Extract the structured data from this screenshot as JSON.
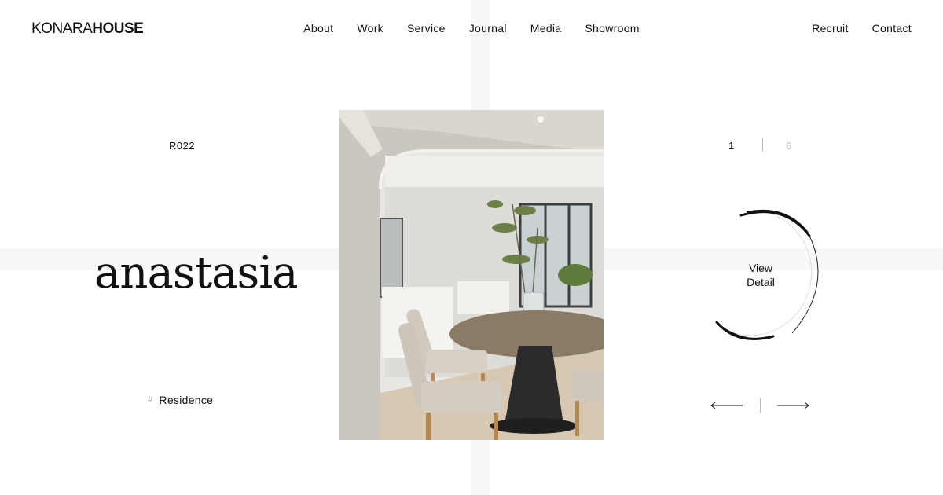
{
  "brand": {
    "logo_light": "KONARA",
    "logo_bold": "HOUSE"
  },
  "nav": {
    "items": [
      "About",
      "Work",
      "Service",
      "Journal",
      "Media",
      "Showroom"
    ],
    "right": [
      "Recruit",
      "Contact"
    ]
  },
  "project": {
    "code": "R022",
    "title": "anastasia",
    "tag_symbol": "#",
    "tag": "Residence"
  },
  "pager": {
    "current": "1",
    "total": "6"
  },
  "view_detail": {
    "line1": "View",
    "line2": "Detail"
  },
  "colors": {
    "text": "#111111",
    "muted": "#bbbbbb",
    "background": "#ffffff"
  },
  "icons": {
    "prev": "arrow-left-icon",
    "next": "arrow-right-icon"
  }
}
